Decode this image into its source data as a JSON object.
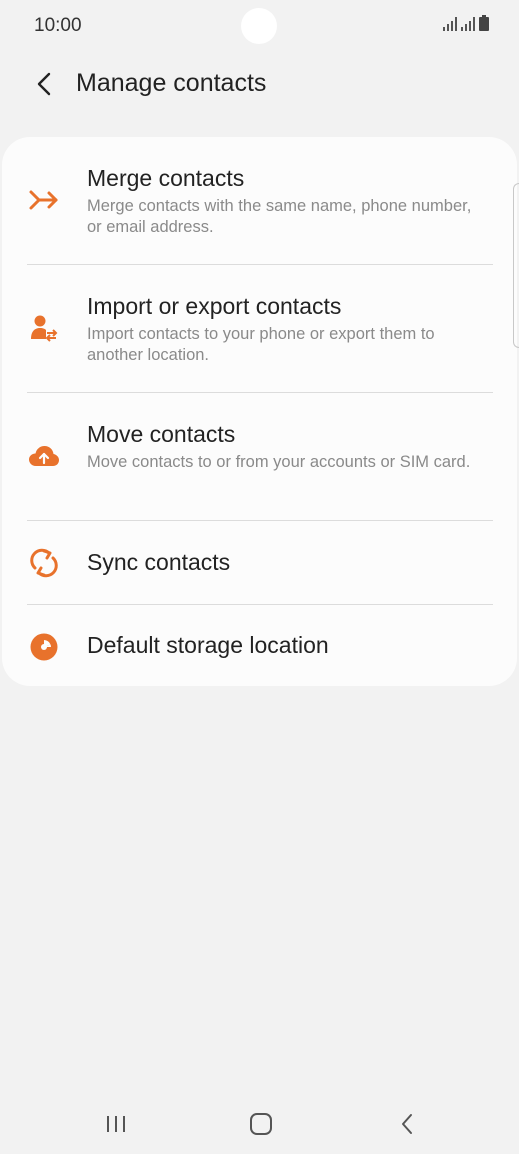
{
  "status_bar": {
    "time": "10:00",
    "icons": [
      "signal-icon",
      "signal-icon",
      "battery-icon"
    ]
  },
  "header": {
    "back_icon": "chevron-left-icon",
    "title": "Manage contacts"
  },
  "accent_color": "#e8722c",
  "menu": {
    "items": [
      {
        "icon": "merge-icon",
        "title": "Merge contacts",
        "subtitle": "Merge contacts with the same name, phone number, or email address."
      },
      {
        "icon": "import-export-icon",
        "title": "Import or export contacts",
        "subtitle": "Import contacts to your phone or export them to another location."
      },
      {
        "icon": "cloud-upload-icon",
        "title": "Move contacts",
        "subtitle": "Move contacts to or from your accounts or SIM card."
      },
      {
        "icon": "sync-icon",
        "title": "Sync contacts",
        "subtitle": ""
      },
      {
        "icon": "storage-pie-icon",
        "title": "Default storage location",
        "subtitle": ""
      }
    ]
  },
  "nav_bar": {
    "recents_icon": "recents-icon",
    "home_icon": "home-icon",
    "back_icon": "back-icon"
  }
}
